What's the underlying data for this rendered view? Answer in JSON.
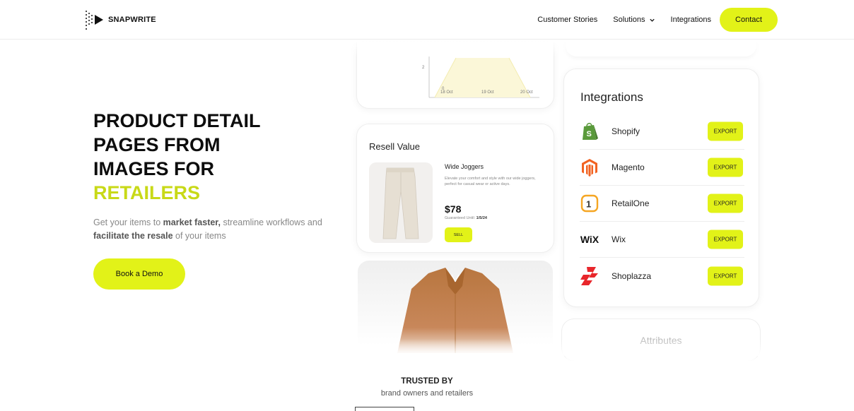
{
  "header": {
    "logo_text": "SNAPWRITE",
    "nav": [
      {
        "label": "Customer Stories"
      },
      {
        "label": "Solutions"
      },
      {
        "label": "Integrations"
      }
    ],
    "contact_label": "Contact"
  },
  "hero": {
    "title_lines": [
      "PRODUCT DETAIL",
      "PAGES FROM",
      "IMAGES FOR"
    ],
    "title_accent": "RETAILERS",
    "subtitle_parts": [
      "Get your items to ",
      "market faster,",
      " streamline workflows and ",
      "facilitate the resale",
      " of your items"
    ],
    "cta_label": "Book a Demo"
  },
  "chart_card": {
    "y_tick": "2",
    "y_tick_zero": "0",
    "x_ticks": [
      "18 Oct",
      "19 Oct",
      "20 Oct"
    ]
  },
  "resell": {
    "title": "Resell Value",
    "product_name": "Wide Joggers",
    "product_desc": "Elevate your comfort and style with our wide joggers, perfect for casual wear or active days.",
    "price": "$78",
    "guarantee_label": "Guaranteed Until: ",
    "guarantee_date": "1/5/24",
    "sell_label": "SELL"
  },
  "integrations": {
    "title": "Integrations",
    "items": [
      {
        "name": "Shopify",
        "icon": "shopify-icon",
        "action": "EXPORT"
      },
      {
        "name": "Magento",
        "icon": "magento-icon",
        "action": "EXPORT"
      },
      {
        "name": "RetailOne",
        "icon": "retailone-icon",
        "action": "EXPORT"
      },
      {
        "name": "Wix",
        "icon": "wix-icon",
        "action": "EXPORT",
        "logo_text": "WiX"
      },
      {
        "name": "Shoplazza",
        "icon": "shoplazza-icon",
        "action": "EXPORT"
      }
    ]
  },
  "attributes": {
    "title": "Attributes"
  },
  "trusted": {
    "title": "TRUSTED BY",
    "subtitle": "brand owners and retailers"
  },
  "colors": {
    "accent": "#e2f218",
    "accent_text": "#c8d917",
    "chart_fill": "#fbf7d8"
  }
}
